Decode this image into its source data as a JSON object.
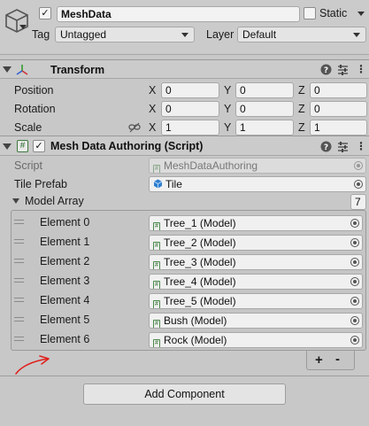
{
  "header": {
    "object_name": "MeshData",
    "active_checked": true,
    "static_label": "Static",
    "static_checked": false,
    "tag_label": "Tag",
    "tag_value": "Untagged",
    "layer_label": "Layer",
    "layer_value": "Default"
  },
  "transform": {
    "title": "Transform",
    "position_label": "Position",
    "rotation_label": "Rotation",
    "scale_label": "Scale",
    "x": "X",
    "y": "Y",
    "z": "Z",
    "position": [
      "0",
      "0",
      "0"
    ],
    "rotation": [
      "0",
      "0",
      "0"
    ],
    "scale": [
      "1",
      "1",
      "1"
    ]
  },
  "script_component": {
    "title": "Mesh Data Authoring (Script)",
    "enabled": true,
    "script_label": "Script",
    "script_value": "MeshDataAuthoring",
    "tile_prefab_label": "Tile Prefab",
    "tile_prefab_value": "Tile",
    "model_array_label": "Model Array",
    "model_array_size": "7",
    "elements": [
      {
        "label": "Element 0",
        "value": "Tree_1 (Model)"
      },
      {
        "label": "Element 1",
        "value": "Tree_2 (Model)"
      },
      {
        "label": "Element 2",
        "value": "Tree_3 (Model)"
      },
      {
        "label": "Element 3",
        "value": "Tree_4 (Model)"
      },
      {
        "label": "Element 4",
        "value": "Tree_5 (Model)"
      },
      {
        "label": "Element 5",
        "value": "Bush (Model)"
      },
      {
        "label": "Element 6",
        "value": "Rock (Model)"
      }
    ],
    "add_label": "+",
    "remove_label": "-"
  },
  "add_component_label": "Add Component",
  "icons": {
    "object": "cube-icon",
    "transform": "transform-axes-icon",
    "script": "script-hash-icon",
    "help": "help-icon",
    "preset": "preset-sliders-icon",
    "menu": "kebab-menu-icon",
    "link": "constrain-proportions-icon",
    "picker": "object-picker-icon",
    "prefab": "prefab-cube-icon",
    "annotation": "red-arrow-annotation"
  },
  "colors": {
    "annotation": "#e0201c",
    "prefab": "#2f7fd0",
    "panel": "#c8c8c8"
  }
}
